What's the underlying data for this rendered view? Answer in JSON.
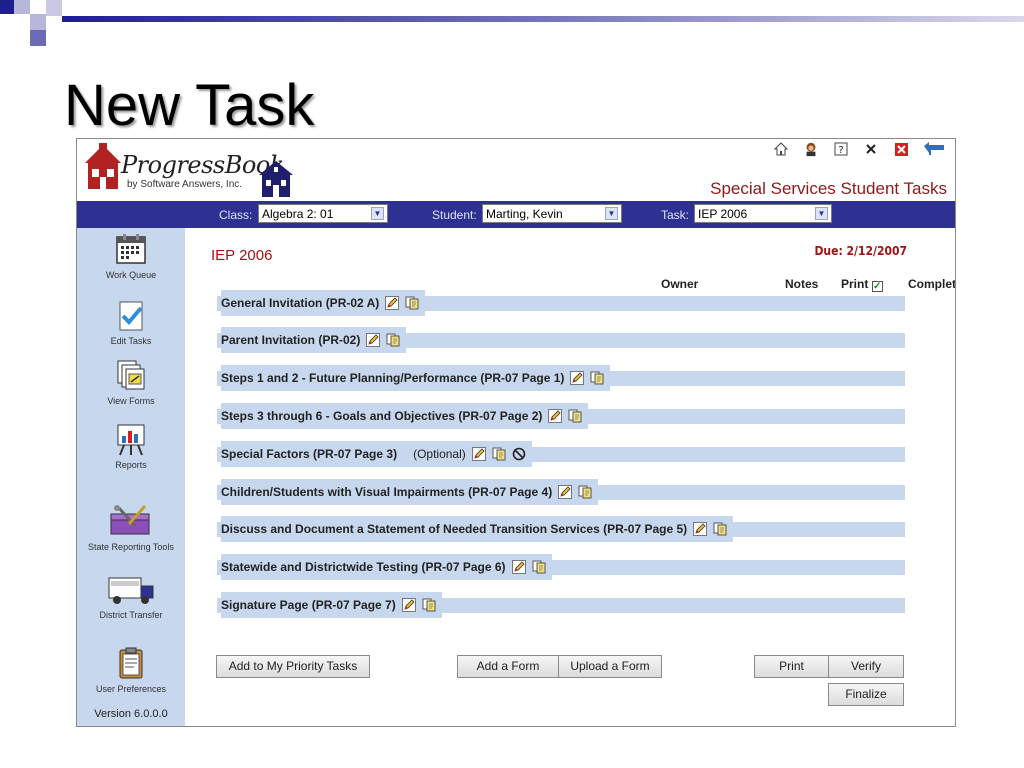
{
  "slide": {
    "title": "New Task"
  },
  "header": {
    "logo_text": "ProgressBook",
    "logo_subtext": "by Software Answers, Inc.",
    "app_title": "Special Services Student Tasks",
    "icons": [
      "home-icon",
      "help-person-icon",
      "help-icon",
      "close-x-icon",
      "close-box-icon",
      "back-arrow-icon"
    ]
  },
  "navbar": {
    "class_label": "Class:",
    "class_value": "Algebra 2: 01",
    "student_label": "Student:",
    "student_value": "Marting, Kevin",
    "task_label": "Task:",
    "task_value": "IEP 2006"
  },
  "sidebar": {
    "items": [
      {
        "label": "Work Queue",
        "icon": "calendar-icon"
      },
      {
        "label": "Edit Tasks",
        "icon": "checkmark-doc-icon"
      },
      {
        "label": "View Forms",
        "icon": "forms-icon"
      },
      {
        "label": "Reports",
        "icon": "chart-easel-icon"
      },
      {
        "label": "State Reporting Tools",
        "icon": "toolbox-icon"
      },
      {
        "label": "District Transfer",
        "icon": "truck-icon"
      },
      {
        "label": "User Preferences",
        "icon": "clipboard-icon"
      }
    ],
    "version": "Version 6.0.0.0"
  },
  "main": {
    "task_title": "IEP 2006",
    "due": "Due:  2/12/2007",
    "columns": {
      "owner": "Owner",
      "notes": "Notes",
      "print": "Print",
      "completed": "Completed?"
    },
    "tasks": [
      {
        "label": "General Invitation  (PR-02 A)",
        "optional": "",
        "has_block": false
      },
      {
        "label": "Parent Invitation  (PR-02)",
        "optional": "",
        "has_block": false
      },
      {
        "label": "Steps 1 and 2 - Future Planning/Performance  (PR-07 Page 1)",
        "optional": "",
        "has_block": false
      },
      {
        "label": "Steps 3 through 6 - Goals and Objectives  (PR-07 Page 2)",
        "optional": "",
        "has_block": false
      },
      {
        "label": "Special Factors  (PR-07 Page 3)",
        "optional": "(Optional)",
        "has_block": true
      },
      {
        "label": "Children/Students with Visual Impairments (PR-07 Page 4)",
        "optional": "",
        "has_block": false
      },
      {
        "label": "Discuss and Document a Statement of Needed Transition Services (PR-07 Page 5)",
        "optional": "",
        "has_block": false
      },
      {
        "label": "Statewide and Districtwide Testing  (PR-07 Page 6)",
        "optional": "",
        "has_block": false
      },
      {
        "label": "Signature Page  (PR-07 Page 7)",
        "optional": "",
        "has_block": false
      }
    ],
    "buttons": {
      "priority": "Add to My Priority Tasks",
      "add_form": "Add a Form",
      "upload_form": "Upload a Form",
      "print": "Print",
      "verify": "Verify",
      "finalize": "Finalize"
    }
  },
  "colors": {
    "navbar": "#2e3192",
    "sidebar": "#c7d7ee",
    "accent_red": "#8b1a1a"
  }
}
